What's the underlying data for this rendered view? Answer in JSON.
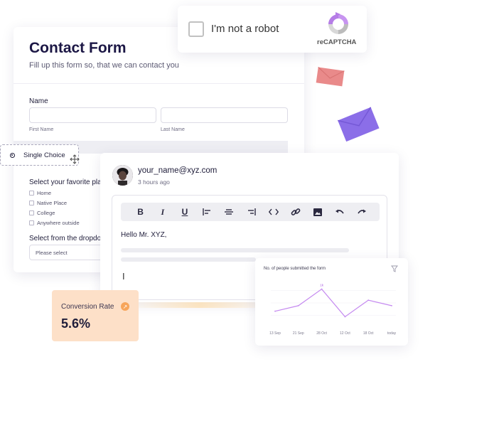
{
  "contact_form": {
    "title": "Contact Form",
    "subtitle": "Fill up this form so, that we can contact you",
    "name_label": "Name",
    "first_name_label": "First Name",
    "last_name_label": "Last Name",
    "favorite_label": "Select your favorite plac",
    "options": [
      "Home",
      "Native Place",
      "College",
      "Anywhere outside"
    ],
    "dropdown_label": "Select from the dropdow",
    "dropdown_placeholder": "Please select"
  },
  "single_choice": {
    "label": "Single Choice"
  },
  "recaptcha": {
    "checkbox_text": "I'm not a robot",
    "brand": "reCAPTCHA"
  },
  "email": {
    "sender": "your_name@xyz.com",
    "time": "3 hours ago",
    "greeting": "Hello Mr. XYZ,",
    "toolbar": [
      "bold-icon",
      "italic-icon",
      "underline-icon",
      "align-left-icon",
      "align-center-icon",
      "align-right-icon",
      "code-icon",
      "link-icon",
      "image-icon",
      "undo-icon",
      "redo-icon"
    ]
  },
  "conversion": {
    "label": "Conversion Rate",
    "value": "5.6%"
  },
  "chart_data": {
    "type": "line",
    "title": "No. of people submitted the form",
    "categories": [
      "13 Sep",
      "21 Sep",
      "28 Oct",
      "12 Oct",
      "18 Oct",
      "today"
    ],
    "values": [
      3,
      4,
      7,
      2,
      5,
      4
    ],
    "peak_label": "1k",
    "ylim": [
      0,
      9
    ],
    "grid": true,
    "line_color": "#c58af0"
  },
  "colors": {
    "accent": "#7c5cf0",
    "envelope_small": "#e98a8a",
    "envelope_big": "#8b6ee8",
    "conversion_bg": "#fde0c8"
  }
}
